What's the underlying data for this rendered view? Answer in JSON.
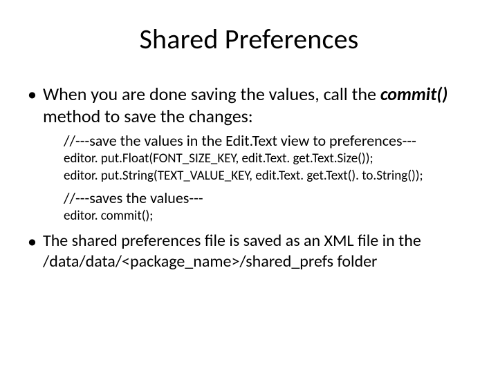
{
  "title": "Shared Preferences",
  "bullets": {
    "first": {
      "pre": "When you are done saving the values, call the ",
      "bold": "commit()",
      "post": " method to save the changes:"
    },
    "code1": {
      "comment": "//---save the values in the Edit.Text view to preferences---",
      "line1": "editor. put.Float(FONT_SIZE_KEY, edit.Text. get.Text.Size());",
      "line2": "editor. put.String(TEXT_VALUE_KEY, edit.Text. get.Text(). to.String());"
    },
    "code2": {
      "comment": "//---saves the values---",
      "line1": "editor. commit();"
    },
    "second": "The shared preferences file is saved as an XML file in the /data/data/<package_name>/shared_prefs folder"
  }
}
